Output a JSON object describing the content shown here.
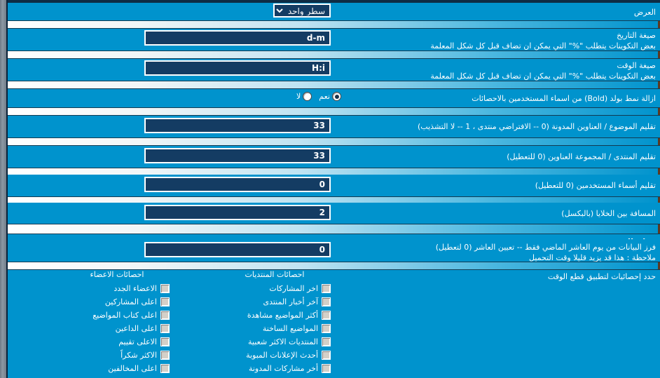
{
  "display": {
    "label": "العرض",
    "select_value": "سطر واحد",
    "options": [
      "سطر واحد"
    ]
  },
  "fields": {
    "date_format": {
      "label": "صيغة التاريخ",
      "hint": "بعض التكوينات يتطلب \"%\" التي يمكن ان تضاف قبل كل شكل المعلمة",
      "value": "d-m"
    },
    "time_format": {
      "label": "صيغة الوقت",
      "hint": "بعض التكوينات يتطلب \"%\" التي يمكن ان تضاف قبل كل شكل المعلمة",
      "value": "H:i"
    },
    "bold_removal": {
      "label": "ازالة نمط بولد (Bold) من اسماء المستخدمين بالاحصائات",
      "yes_label": "نعم",
      "no_label": "لا",
      "selected": "yes"
    },
    "topic_trim": {
      "label": "تقليم الموضوع / العناوين المدونة (0 -- الافتراضي منتدى ، 1 -- لا التشذيب)",
      "value": "33"
    },
    "forum_trim": {
      "label": "تقليم المنتدى / المجموعة العناوين (0 للتعطيل)",
      "value": "33"
    },
    "username_trim": {
      "label": "تقليم أسماء المستخدمين (0 للتعطيل)",
      "value": "0"
    },
    "cell_spacing": {
      "label": "المسافة بين الخلايا (بالبكسل)",
      "value": "2"
    }
  },
  "timecut": {
    "section_title": "قطع الوقت",
    "sort_label": "فرز البيانات من يوم العاشر الماضي فقط -- تعيين العاشر (0 لتعطيل)",
    "sort_note": "ملاحظة : هذا قد يزيد قليلا وقت التحميل",
    "sort_value": "0",
    "select_stats_label": "حدد إحصائيات لتطبيق قطع الوقت"
  },
  "checkbox_columns": [
    {
      "header": "احصائات المنتديات",
      "items": [
        "اخر المشاركات",
        "آخر أخبار المنتدى",
        "أكثر المواضيع مشاهدة",
        "المواضيع الساخنة",
        "المنتديات الاكثر شعبية",
        "أحدث الإعلانات المبوبة",
        "أخر مشاركات المدونة"
      ]
    },
    {
      "header": "احصائات الاعضاء",
      "items": [
        "الاعضاء الجدد",
        "اعلى المشاركين",
        "اعلى كتاب المواضيع",
        "اعلى الداعين",
        "الاعلى تقييم",
        "الاكثر شكراً",
        "اعلى المخالفين"
      ]
    }
  ],
  "colors": {
    "background": "#0093cd",
    "input_bg": "#143c63",
    "text": "#ffffff"
  }
}
